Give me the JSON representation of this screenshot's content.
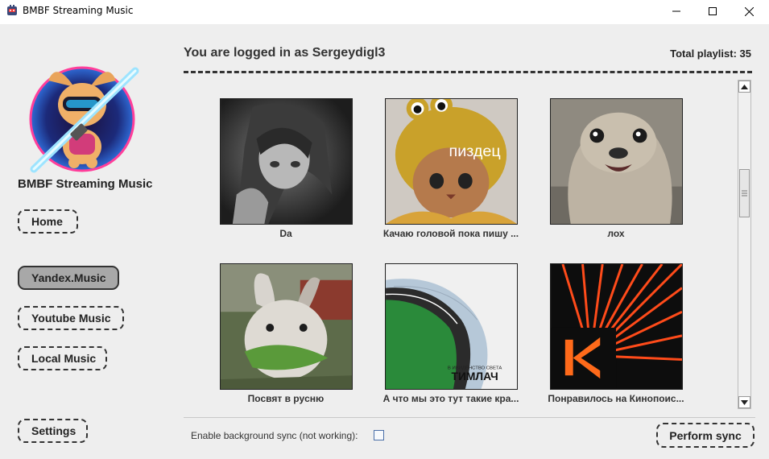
{
  "window": {
    "title": "BMBF Streaming Music"
  },
  "sidebar": {
    "brand": "BMBF Streaming Music",
    "logo_icon": "astronaut-dog-lightsaber-logo",
    "nav": [
      {
        "label": "Home",
        "active": false
      },
      {
        "label": "Yandex.Music",
        "active": true
      },
      {
        "label": "Youtube Music",
        "active": false
      },
      {
        "label": "Local Music",
        "active": false
      }
    ],
    "settings_label": "Settings"
  },
  "header": {
    "user_text": "You are logged in as Sergeydigl3",
    "total_text": "Total playlist: 35"
  },
  "main": {
    "playlists": [
      {
        "title": "Da",
        "cover": "anime-girl-grayscale"
      },
      {
        "title": "Качаю головой пока пишу ...",
        "cover": "cat-in-frog-hat",
        "cover_text": "пиздец"
      },
      {
        "title": "лох",
        "cover": "seal-photo"
      },
      {
        "title": "Посвят в руcню",
        "cover": "rabbit-eating-leaves"
      },
      {
        "title": "А что мы это тут такие кра...",
        "cover": "race-track-map",
        "cover_text_1": "В ИВИДЕНСТВО СВЕТА",
        "cover_text_2": "ТИМЛАЧ"
      },
      {
        "title": "Понравилось на Кинопоис...",
        "cover": "kinopoisk-logo-rays"
      }
    ]
  },
  "footer": {
    "bg_sync_label": "Enable background sync (not working):",
    "bg_sync_checked": false,
    "perform_sync_label": "Perform sync"
  },
  "colors": {
    "background": "#eeeeee",
    "active_nav": "#a8a8a8",
    "text": "#222222"
  }
}
